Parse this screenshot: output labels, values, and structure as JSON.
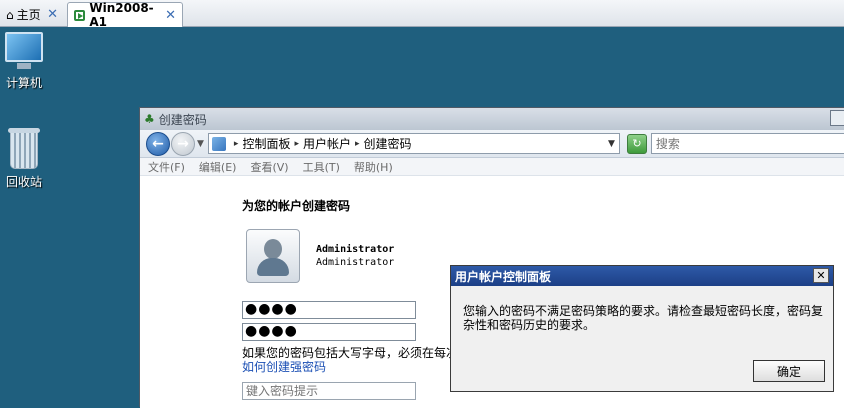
{
  "host_tabs": [
    {
      "label": "主页",
      "icon": "home-icon"
    },
    {
      "label": "Win2008-A1",
      "icon": "vm-icon"
    }
  ],
  "desktop": {
    "icons": [
      {
        "label": "计算机",
        "icon": "computer-icon"
      },
      {
        "label": "回收站",
        "icon": "recycle-bin-icon"
      }
    ]
  },
  "window": {
    "title": "创建密码",
    "breadcrumb": [
      "控制面板",
      "用户帐户",
      "创建密码"
    ],
    "search_placeholder": "搜索",
    "menu": [
      "文件(F)",
      "编辑(E)",
      "查看(V)",
      "工具(T)",
      "帮助(H)"
    ]
  },
  "content": {
    "heading": "为您的帐户创建密码",
    "user_name": "Administrator",
    "user_type": "Administrator",
    "password_mask": "●●●●",
    "confirm_mask": "●●●●",
    "hint_text": "如果您的密码包括大写字母，必须在每次登录",
    "hint_link": "如何创建强密码",
    "hint_placeholder": "键入密码提示"
  },
  "dialog": {
    "title": "用户帐户控制面板",
    "message": "您输入的密码不满足密码策略的要求。请检查最短密码长度，密码复杂性和密码历史的要求。",
    "ok_label": "确定"
  },
  "colors": {
    "desktop": "#1f5f7e",
    "dialog_title": "#2e5aa8",
    "link": "#1b4fb4"
  }
}
